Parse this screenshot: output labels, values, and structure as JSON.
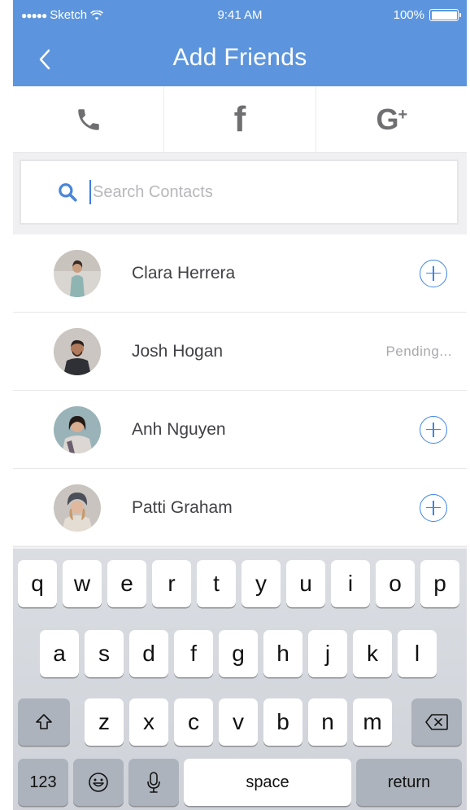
{
  "status_bar": {
    "carrier": "Sketch",
    "time": "9:41 AM",
    "battery": "100%"
  },
  "nav": {
    "title": "Add Friends"
  },
  "social_tabs": [
    {
      "icon": "phone-icon"
    },
    {
      "icon": "facebook-icon",
      "glyph": "f"
    },
    {
      "icon": "google-plus-icon",
      "glyph": "G",
      "glyph_sup": "+"
    }
  ],
  "search": {
    "placeholder": "Search Contacts",
    "value": ""
  },
  "contacts": [
    {
      "name": "Clara Herrera",
      "status": "add"
    },
    {
      "name": "Josh Hogan",
      "status": "pending",
      "status_label": "Pending..."
    },
    {
      "name": "Anh Nguyen",
      "status": "add"
    },
    {
      "name": "Patti Graham",
      "status": "add"
    }
  ],
  "keyboard": {
    "row1": [
      "q",
      "w",
      "e",
      "r",
      "t",
      "y",
      "u",
      "i",
      "o",
      "p"
    ],
    "row2": [
      "a",
      "s",
      "d",
      "f",
      "g",
      "h",
      "j",
      "k",
      "l"
    ],
    "row3": [
      "z",
      "x",
      "c",
      "v",
      "b",
      "n",
      "m"
    ],
    "numbers_label": "123",
    "space_label": "space",
    "return_label": "return"
  },
  "colors": {
    "accent": "#5c95dd",
    "add_button": "#3d85e6",
    "caret": "#3d7fe0"
  }
}
